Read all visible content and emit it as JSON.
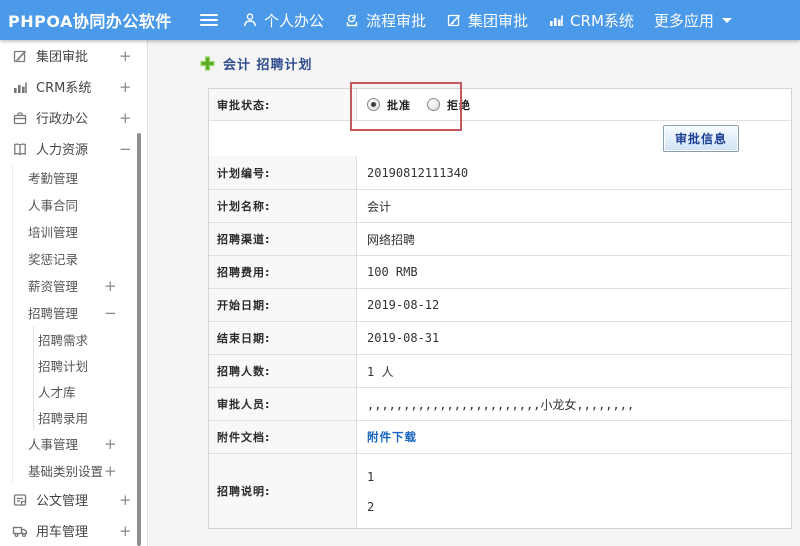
{
  "app": {
    "brand": "PHPOA协同办公软件"
  },
  "navbar": {
    "menu": [
      {
        "id": "personal",
        "icon": "person-icon",
        "label": "个人办公"
      },
      {
        "id": "process",
        "icon": "process-approval-icon",
        "label": "流程审批"
      },
      {
        "id": "group",
        "icon": "edit-square-icon",
        "label": "集团审批"
      },
      {
        "id": "crm",
        "icon": "bar-chart-icon",
        "label": "CRM系统"
      },
      {
        "id": "more-apps",
        "icon": "",
        "label": "更多应用",
        "caret": true
      }
    ]
  },
  "sidebar": {
    "items": [
      {
        "id": "group-approval",
        "label": "集团审批",
        "level": 1,
        "icon": "edit-square-icon",
        "expand": "+"
      },
      {
        "id": "crm-system",
        "label": "CRM系统",
        "level": 1,
        "icon": "bar-chart-icon",
        "expand": "+"
      },
      {
        "id": "admin-office",
        "label": "行政办公",
        "level": 1,
        "icon": "briefcase-icon",
        "expand": "+"
      },
      {
        "id": "hr",
        "label": "人力资源",
        "level": 1,
        "icon": "book-icon",
        "expand": "−"
      },
      {
        "id": "attendance",
        "label": "考勤管理",
        "level": 2,
        "expand": ""
      },
      {
        "id": "hr-contract",
        "label": "人事合同",
        "level": 2,
        "expand": ""
      },
      {
        "id": "training",
        "label": "培训管理",
        "level": 2,
        "expand": ""
      },
      {
        "id": "rewards",
        "label": "奖惩记录",
        "level": 2,
        "expand": ""
      },
      {
        "id": "salary",
        "label": "薪资管理",
        "level": 2,
        "expand": "+"
      },
      {
        "id": "recruit",
        "label": "招聘管理",
        "level": 2,
        "expand": "−"
      },
      {
        "id": "recruit-demand",
        "label": "招聘需求",
        "level": 3,
        "expand": ""
      },
      {
        "id": "recruit-plan",
        "label": "招聘计划",
        "level": 3,
        "expand": ""
      },
      {
        "id": "talent-pool",
        "label": "人才库",
        "level": 3,
        "expand": ""
      },
      {
        "id": "recruit-hire",
        "label": "招聘录用",
        "level": 3,
        "expand": ""
      },
      {
        "id": "personnel",
        "label": "人事管理",
        "level": 2,
        "expand": "+"
      },
      {
        "id": "base-category",
        "label": "基础类别设置",
        "level": 2,
        "expand": "+"
      },
      {
        "id": "doc-manage",
        "label": "公文管理",
        "level": 1,
        "icon": "doc-icon",
        "expand": "+"
      },
      {
        "id": "vehicle-manage",
        "label": "用车管理",
        "level": 1,
        "icon": "truck-icon",
        "expand": "+"
      }
    ]
  },
  "main": {
    "title": "会计 招聘计划",
    "approval_status": {
      "label": "审批状态:",
      "options": [
        {
          "label": "批准",
          "selected": true
        },
        {
          "label": "拒绝",
          "selected": false
        }
      ]
    },
    "approval_info_button": "审批信息",
    "rows": [
      {
        "id": "plan-no",
        "label": "计划编号:",
        "value": "20190812111340"
      },
      {
        "id": "plan-name",
        "label": "计划名称:",
        "value": "会计"
      },
      {
        "id": "channel",
        "label": "招聘渠道:",
        "value": "网络招聘"
      },
      {
        "id": "cost",
        "label": "招聘费用:",
        "value": "100 RMB"
      },
      {
        "id": "start-date",
        "label": "开始日期:",
        "value": "2019-08-12"
      },
      {
        "id": "end-date",
        "label": "结束日期:",
        "value": "2019-08-31"
      },
      {
        "id": "headcount",
        "label": "招聘人数:",
        "value": "1 人"
      },
      {
        "id": "approvers",
        "label": "审批人员:",
        "value": ",,,,,,,,,,,,,,,,,,,,,,,,小龙女,,,,,,,,"
      },
      {
        "id": "attachment",
        "label": "附件文档:",
        "value": "附件下载",
        "link": true
      },
      {
        "id": "description",
        "label": "招聘说明:",
        "lines": [
          "1",
          "2"
        ]
      }
    ]
  },
  "colors": {
    "navbar_blue": "#4b99e9",
    "annotation_red": "#c5585f",
    "link_blue": "#1a66c0",
    "title_blue": "#2f4d8f",
    "plus_green": "#57ab27"
  }
}
